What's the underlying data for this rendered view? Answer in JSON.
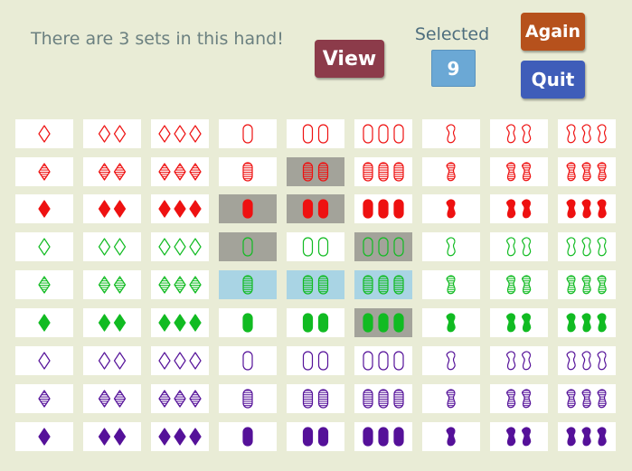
{
  "message": "There are 3 sets in this hand!",
  "buttons": {
    "view": "View",
    "again": "Again",
    "quit": "Quit"
  },
  "selected": {
    "label": "Selected",
    "count": "9"
  },
  "colors": {
    "red": "#ee1111",
    "green": "#11bb22",
    "purple": "#551199",
    "card_bg": "#ffffff",
    "hint_gray": "#a3a39a",
    "selected_blue": "#a9d4e4"
  },
  "grid": {
    "row_colors": [
      "red",
      "red",
      "red",
      "green",
      "green",
      "green",
      "purple",
      "purple",
      "purple"
    ],
    "row_fills": [
      "empty",
      "striped",
      "solid",
      "empty",
      "striped",
      "solid",
      "empty",
      "striped",
      "solid"
    ],
    "col_shapes": [
      "diamond",
      "diamond",
      "diamond",
      "oval",
      "oval",
      "oval",
      "squiggle",
      "squiggle",
      "squiggle"
    ],
    "col_counts": [
      1,
      2,
      3,
      1,
      2,
      3,
      1,
      2,
      3
    ],
    "highlights": [
      {
        "row": 1,
        "col": 4,
        "state": "hint"
      },
      {
        "row": 2,
        "col": 3,
        "state": "hint"
      },
      {
        "row": 2,
        "col": 4,
        "state": "hint"
      },
      {
        "row": 3,
        "col": 3,
        "state": "hint"
      },
      {
        "row": 3,
        "col": 5,
        "state": "hint"
      },
      {
        "row": 4,
        "col": 3,
        "state": "selected"
      },
      {
        "row": 4,
        "col": 4,
        "state": "selected"
      },
      {
        "row": 4,
        "col": 5,
        "state": "selected"
      },
      {
        "row": 5,
        "col": 5,
        "state": "hint"
      }
    ]
  }
}
